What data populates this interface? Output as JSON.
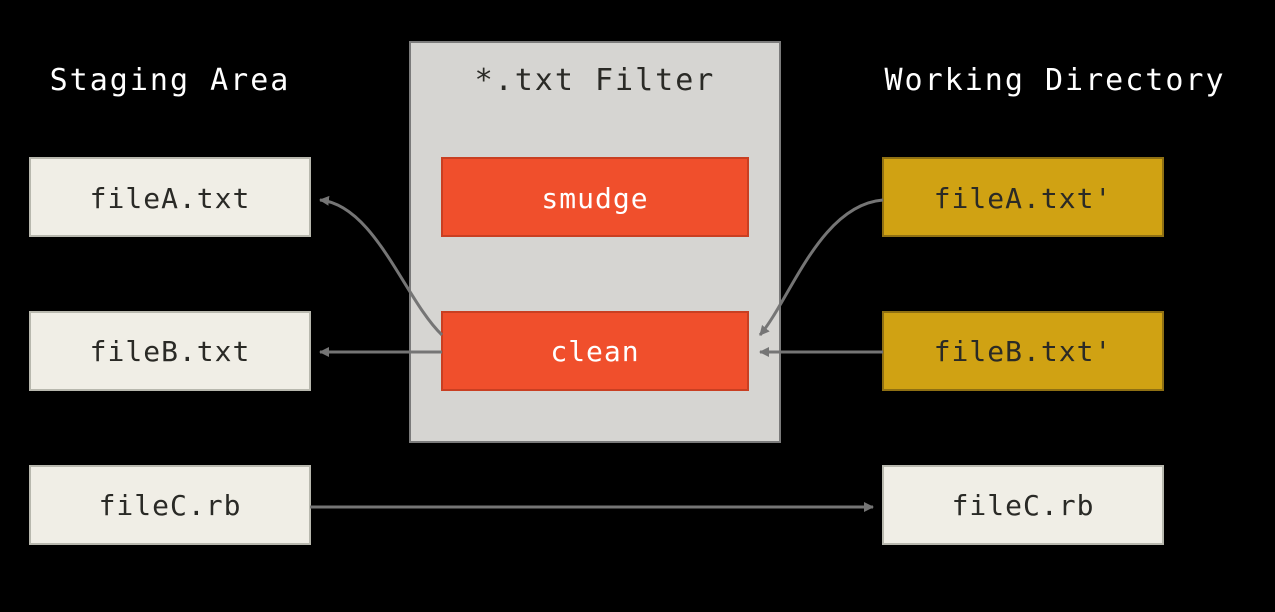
{
  "columns": {
    "left_title": "Staging Area",
    "center_title": "*.txt Filter",
    "right_title": "Working Directory"
  },
  "left_files": {
    "a": "fileA.txt",
    "b": "fileB.txt",
    "c": "fileC.rb"
  },
  "right_files": {
    "a": "fileA.txt'",
    "b": "fileB.txt'",
    "c": "fileC.rb"
  },
  "filters": {
    "smudge": "smudge",
    "clean": "clean"
  },
  "colors": {
    "bg": "#000000",
    "box_bg": "#f0eee6",
    "box_yellow": "#d0a213",
    "filter_btn": "#f04f2c",
    "filter_container": "#d6d5d2",
    "arrow": "#757575",
    "text_white": "#ffffff",
    "text_dark": "#2a2a26"
  }
}
